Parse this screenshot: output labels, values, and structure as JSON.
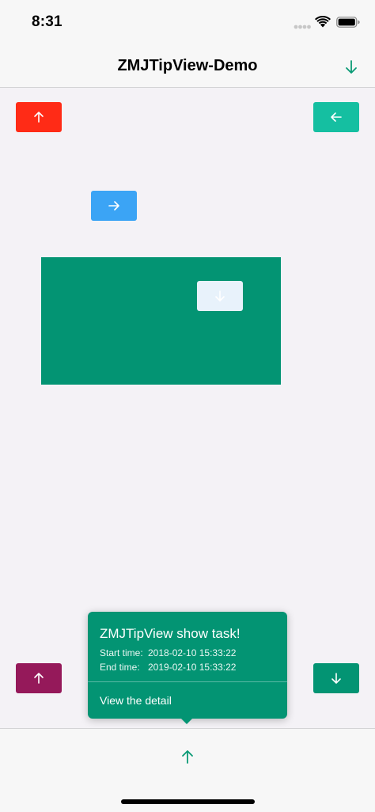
{
  "status_bar": {
    "time": "8:31",
    "signal_icon": "cellular-signal-icon",
    "wifi_icon": "wifi-icon",
    "battery_icon": "battery-icon"
  },
  "nav": {
    "title": "ZMJTipView-Demo",
    "right_icon": "arrow-down-icon"
  },
  "buttons": {
    "top_left": {
      "icon": "arrow-up-icon",
      "color": "#ff2b16"
    },
    "top_right": {
      "icon": "arrow-left-icon",
      "color": "#15bfa1"
    },
    "middle": {
      "icon": "arrow-right-icon",
      "color": "#3ba4f5"
    },
    "in_box": {
      "icon": "arrow-down-icon",
      "color": "#e8f2fb"
    },
    "bottom_left": {
      "icon": "arrow-up-icon",
      "color": "#95195a"
    },
    "bottom_right": {
      "icon": "arrow-down-icon",
      "color": "#039473"
    }
  },
  "box_color": "#039473",
  "tip": {
    "title": "ZMJTipView show task!",
    "start_label": "Start time:",
    "start_value": "2018-02-10 15:33:22",
    "end_label": "End time:",
    "end_value": "2019-02-10 15:33:22",
    "link": "View the detail",
    "color": "#039473"
  },
  "toolbar": {
    "icon": "arrow-up-icon",
    "accent": "#0a9a75"
  }
}
